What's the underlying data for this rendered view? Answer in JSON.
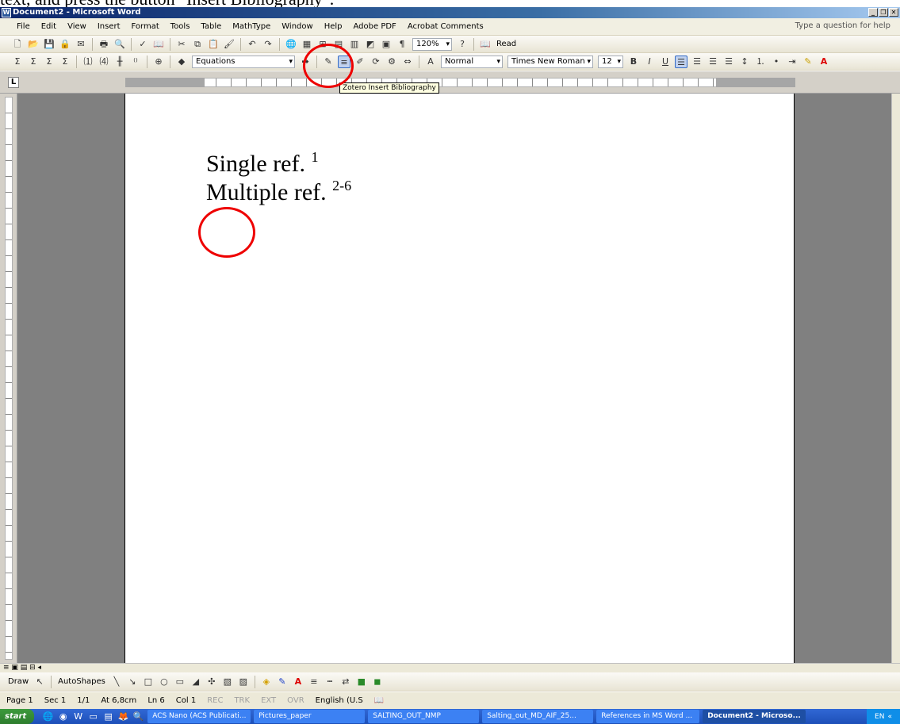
{
  "caption": "text, and press the button \"Insert Bibliography\".",
  "window": {
    "title": "Document2 - Microsoft Word"
  },
  "menu": {
    "items": [
      "File",
      "Edit",
      "View",
      "Insert",
      "Format",
      "Tools",
      "Table",
      "MathType",
      "Window",
      "Help",
      "Adobe PDF",
      "Acrobat Comments"
    ],
    "help_placeholder": "Type a question for help"
  },
  "toolbar1": {
    "zoom": "120%",
    "read_label": "Read"
  },
  "toolbar2": {
    "equations_dropdown": "Equations",
    "style_dropdown": "Normal",
    "font_dropdown": "Times New Roman",
    "size_dropdown": "12"
  },
  "tooltip": "Zotero Insert Bibliography",
  "document": {
    "line1_text": "Single ref.",
    "line1_sup": "1",
    "line2_text": "Multiple ref.",
    "line2_sup": "2-6"
  },
  "drawbar": {
    "draw_label": "Draw",
    "autoshapes_label": "AutoShapes"
  },
  "status": {
    "page": "Page 1",
    "section": "Sec 1",
    "pages": "1/1",
    "at": "At 6,8cm",
    "ln": "Ln 6",
    "col": "Col 1",
    "rec": "REC",
    "trk": "TRK",
    "ext": "EXT",
    "ovr": "OVR",
    "language": "English (U.S"
  },
  "taskbar": {
    "start_label": "start",
    "tasks": [
      "ACS Nano (ACS Publicati...",
      "Pictures_paper",
      "SALTING_OUT_NMP",
      "Salting_out_MD_AIF_25...",
      "References in MS Word ...",
      "Document2 - Microso..."
    ],
    "tray_lang": "EN"
  },
  "colors": {
    "highlight_circle": "#e00000",
    "title_bar": "#0a246a"
  }
}
